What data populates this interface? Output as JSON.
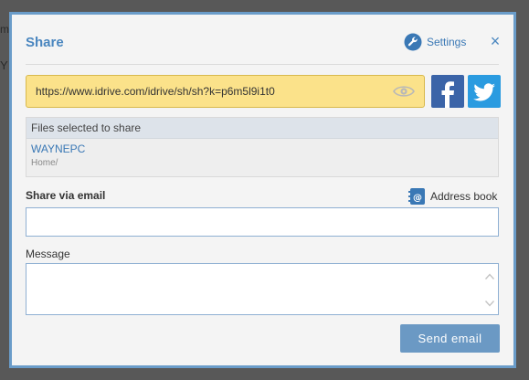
{
  "background": {
    "fragment_1": "m",
    "fragment_2": "Y"
  },
  "dialog": {
    "title": "Share",
    "settings_label": "Settings",
    "close_glyph": "×",
    "share_url": "https://www.idrive.com/idrive/sh/sh?k=p6m5l9i1t0",
    "files": {
      "header": "Files selected to share",
      "items": [
        {
          "name": "WAYNEPC",
          "path": "Home/"
        }
      ]
    },
    "email": {
      "label": "Share via email",
      "address_book_label": "Address book",
      "value": ""
    },
    "message": {
      "label": "Message",
      "value": ""
    },
    "send_label": "Send email"
  },
  "colors": {
    "accent": "#4a86bf",
    "url_bg": "#fbe28a",
    "facebook": "#3b64a8",
    "twitter": "#2a9be0",
    "send_button": "#6b99c4"
  },
  "icons": {
    "settings": "wrench-icon",
    "close": "close-icon",
    "visibility": "eye-icon",
    "facebook": "facebook-icon",
    "twitter": "twitter-icon",
    "address_book": "address-book-icon",
    "scroll_up": "chevron-up-icon",
    "scroll_down": "chevron-down-icon"
  }
}
